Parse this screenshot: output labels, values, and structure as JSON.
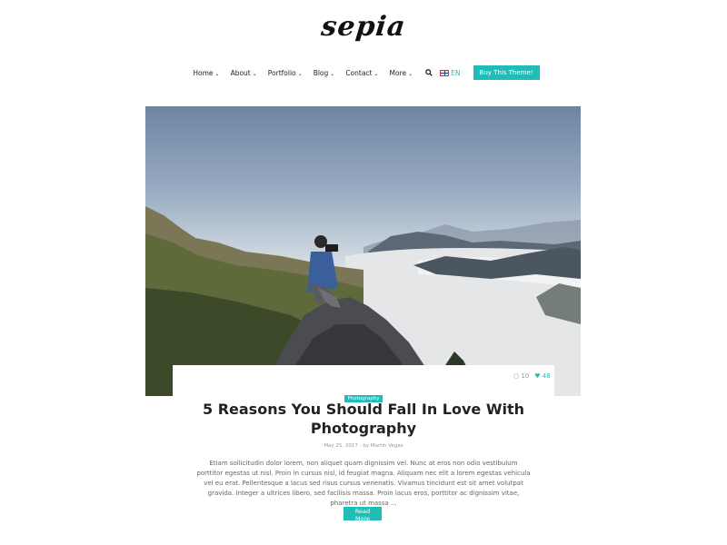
{
  "brand": {
    "logo": "sepia",
    "accent": "#1fbdb5"
  },
  "nav": {
    "items": [
      {
        "label": "Home"
      },
      {
        "label": "About"
      },
      {
        "label": "Portfolio"
      },
      {
        "label": "Blog"
      },
      {
        "label": "Contact"
      },
      {
        "label": "More"
      }
    ],
    "search_icon": "search-icon",
    "language": "EN",
    "buy_button": "Buy This Theme!"
  },
  "post": {
    "comments": "10",
    "likes": "48",
    "category": "Photography",
    "title": "5 Reasons You Should Fall In Love With Photography",
    "date": "May 25, 2017",
    "by": "- by",
    "author": "Martin Vegas",
    "excerpt": "Etiam sollicitudin dolor lorem, non aliquet quam dignissim vel. Nunc at eros non odio vestibulum porttitor egestas ut nisl. Proin in cursus nisl, id feugiat magna. Aliquam nec elit a lorem egestas vehicula vel eu erat. Pellentesque a lacus sed risus cursus venenatis. Vivamus tincidunt est sit amet volutpat gravida. Integer a ultrices libero, sed facilisis massa. Proin lacus eros, porttitor ac dignissim vitae, pharetra ut massa ...",
    "read_more": "Read More"
  }
}
